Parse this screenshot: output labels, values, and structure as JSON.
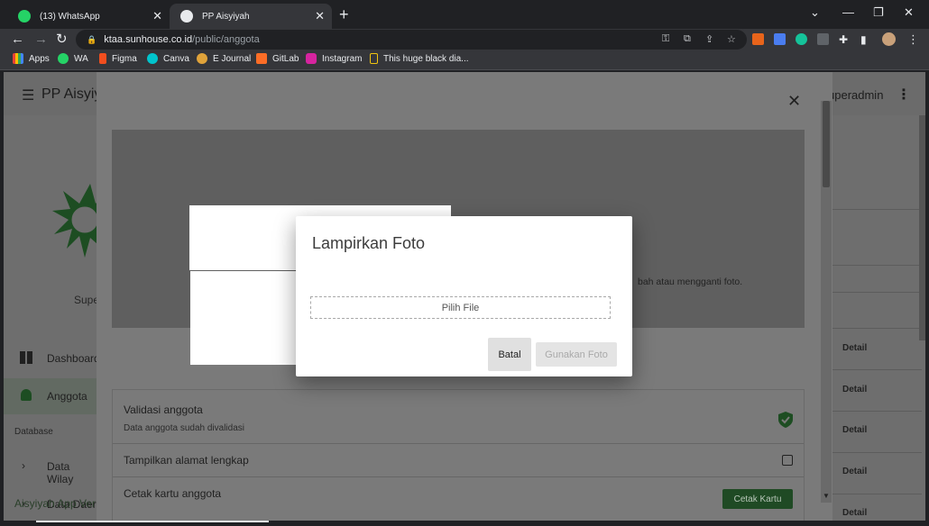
{
  "browser": {
    "tabs": [
      {
        "label": "(13) WhatsApp",
        "active": false
      },
      {
        "label": "PP Aisyiyah",
        "active": true
      }
    ],
    "url_host": "ktaa.sunhouse.co.id",
    "url_path": "/public/anggota",
    "bookmarks": [
      {
        "label": "Apps",
        "icon": "apps-grid-icon",
        "color": "#e8eaed"
      },
      {
        "label": "WA",
        "icon": "whatsapp-icon",
        "color": "#25d366"
      },
      {
        "label": "Figma",
        "icon": "figma-icon",
        "color": "#f24e1e"
      },
      {
        "label": "Canva",
        "icon": "canva-icon",
        "color": "#00c4cc"
      },
      {
        "label": "E Journal",
        "icon": "ejournal-icon",
        "color": "#e0a33a"
      },
      {
        "label": "GitLab",
        "icon": "gitlab-icon",
        "color": "#fc6d26"
      },
      {
        "label": "Instagram",
        "icon": "instagram-icon",
        "color": "#d6249f"
      },
      {
        "label": "This huge black dia...",
        "icon": "bookmark-doc-icon",
        "color": "#f1c40f"
      }
    ]
  },
  "app": {
    "title": "PP Aisyiy",
    "user": "uperadmin",
    "role": "Supe",
    "nav": [
      {
        "label": "Dashboard",
        "icon": "dashboard-icon"
      },
      {
        "label": "Anggota",
        "icon": "person-icon",
        "active": true
      }
    ],
    "section_label": "Database",
    "db_items": [
      {
        "label": "Data Wilay"
      },
      {
        "label": "Data Daer"
      }
    ],
    "footer": "Aisyiyah App Ver",
    "detail_label": "Detail"
  },
  "outer_dialog": {
    "photo_hint": "bah atau mengganti foto.",
    "settings": [
      {
        "title": "Validasi anggota",
        "subtitle": "Data anggota sudah divalidasi",
        "control": "verified-check-icon"
      },
      {
        "title": "Tampilkan alamat lengkap",
        "control": "checkbox"
      },
      {
        "title": "Cetak kartu anggota",
        "button": "Cetak Kartu"
      }
    ]
  },
  "modal": {
    "title": "Lampirkan Foto",
    "file_picker": "Pilih File",
    "cancel": "Batal",
    "use_photo": "Gunakan Foto"
  }
}
